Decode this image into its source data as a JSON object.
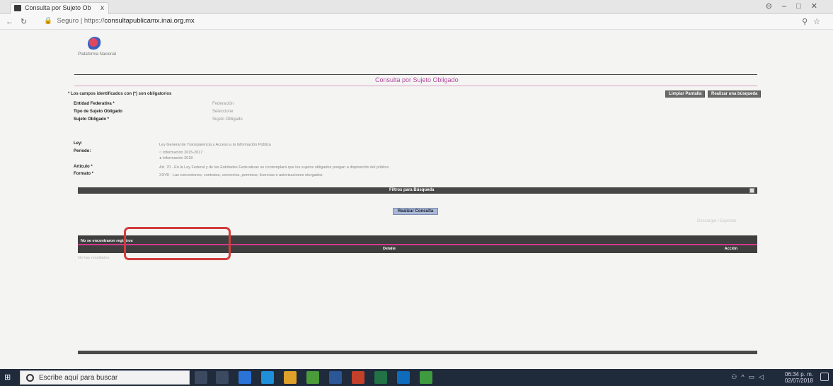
{
  "browser": {
    "tab_title": "Consulta por Sujeto Ob",
    "tab_close": "x",
    "url_prefix": "Seguro",
    "url_scheme": "https://",
    "url_host": "consultapublicamx.inai.org.mx"
  },
  "page": {
    "logo_text": "Plataforma Nacional",
    "title": "Consulta por Sujeto Obligado",
    "required_note": "* Los campos identificados con (*) son obligatorios",
    "clear_button": "Limpiar Pantalla",
    "new_search_button": "Realizar una búsqueda"
  },
  "form": {
    "fields": [
      {
        "label": "Entidad Federativa *",
        "value": "Federación"
      },
      {
        "label": "Tipo de Sujeto Obligado",
        "value": "Seleccione"
      },
      {
        "label": "Sujeto Obligado *",
        "value": "Sujeto Obligado"
      }
    ],
    "ley_label": "Ley:",
    "ley_value": "Ley General de Transparencia y Acceso a la Información Pública",
    "periodo_label": "Periodo:",
    "periodo_option_1": "Información 2015-2017",
    "periodo_option_2": "Información 2018",
    "articulo_label": "Artículo *",
    "articulo_value": "Art. 70 - En la Ley Federal y de las Entidades Federativas se contemplará que los sujetos obligados pongan a disposición del público",
    "formato_label": "Formato *",
    "formato_value": "XXVII - Las concesiones, contratos, convenios, permisos, licencias o autorizaciones otorgados"
  },
  "filters": {
    "bar_label": "Filtros para Búsqueda",
    "toggle": "+"
  },
  "results": {
    "consult_button": "Realizar Consulta",
    "export_link": "Descargar / Exportar",
    "header_1": "No se encontraron registros",
    "header_2": "Detalle",
    "header_3": "Acción",
    "no_data": "No hay resultados"
  },
  "taskbar": {
    "search_placeholder": "Escribe aquí para buscar",
    "time": "06:34 p. m.",
    "date": "02/07/2018"
  },
  "colors": {
    "accent_pink": "#d13a8a",
    "highlight_red": "#d23c3c",
    "consult_blue": "#a9b8d6",
    "title_magenta": "#b04aa0"
  }
}
